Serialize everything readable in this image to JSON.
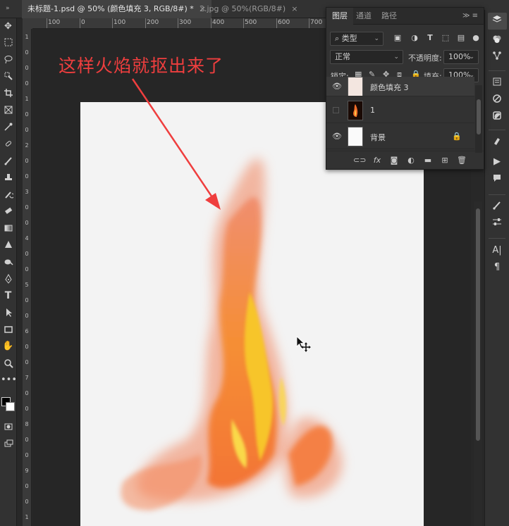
{
  "tabs": [
    {
      "label": "未标题-1.psd @ 50% (颜色填充 3, RGB/8#) *",
      "close": "×"
    },
    {
      "label": "2.jpg @ 50%(RGB/8#)",
      "close": "×"
    }
  ],
  "ruler": {
    "h_labels": [
      "100",
      "0",
      "100",
      "200",
      "300",
      "400",
      "500",
      "600",
      "700"
    ],
    "v_labels": [
      "1",
      "0",
      "0",
      "0",
      "1",
      "0",
      "0",
      "2",
      "0",
      "0",
      "3",
      "0",
      "0",
      "4",
      "0",
      "0",
      "5",
      "0",
      "0",
      "6",
      "0",
      "0",
      "7",
      "0",
      "0",
      "8",
      "0",
      "0",
      "9",
      "0",
      "0",
      "1"
    ]
  },
  "annotation": {
    "text": "这样火焰就抠出来了",
    "color": "#ef3e3e"
  },
  "layers_panel": {
    "tabs": [
      "图层",
      "通道",
      "路径"
    ],
    "filter_kind": "类型",
    "blend_mode": "正常",
    "opacity_label": "不透明度:",
    "opacity_value": "100%",
    "lock_label": "锁定:",
    "fill_label": "填充:",
    "fill_value": "100%",
    "layers": [
      {
        "name": "颜色填充 3",
        "visible": true,
        "thumb": "fill"
      },
      {
        "name": "1",
        "visible": false,
        "thumb": "flame"
      },
      {
        "name": "背景",
        "visible": true,
        "thumb": "white",
        "locked": true
      }
    ]
  },
  "icons": {
    "toolbar": [
      "move-icon",
      "marquee-icon",
      "lasso-icon",
      "quick-select-icon",
      "crop-icon",
      "frame-icon",
      "eyedropper-icon",
      "healing-icon",
      "brush-icon",
      "stamp-icon",
      "history-brush-icon",
      "eraser-icon",
      "gradient-icon",
      "blur-icon",
      "dodge-icon",
      "pen-icon",
      "type-icon",
      "path-select-icon",
      "rectangle-icon",
      "hand-icon",
      "zoom-icon",
      "more-icon"
    ],
    "right_strip": [
      "layers-icon",
      "color-icon",
      "adjust-icon",
      "properties-icon",
      "libraries-icon",
      "styles-icon",
      "play-icon",
      "comment-icon",
      "brushes-icon",
      "sliders-icon",
      "character-icon",
      "paragraph-icon"
    ]
  }
}
